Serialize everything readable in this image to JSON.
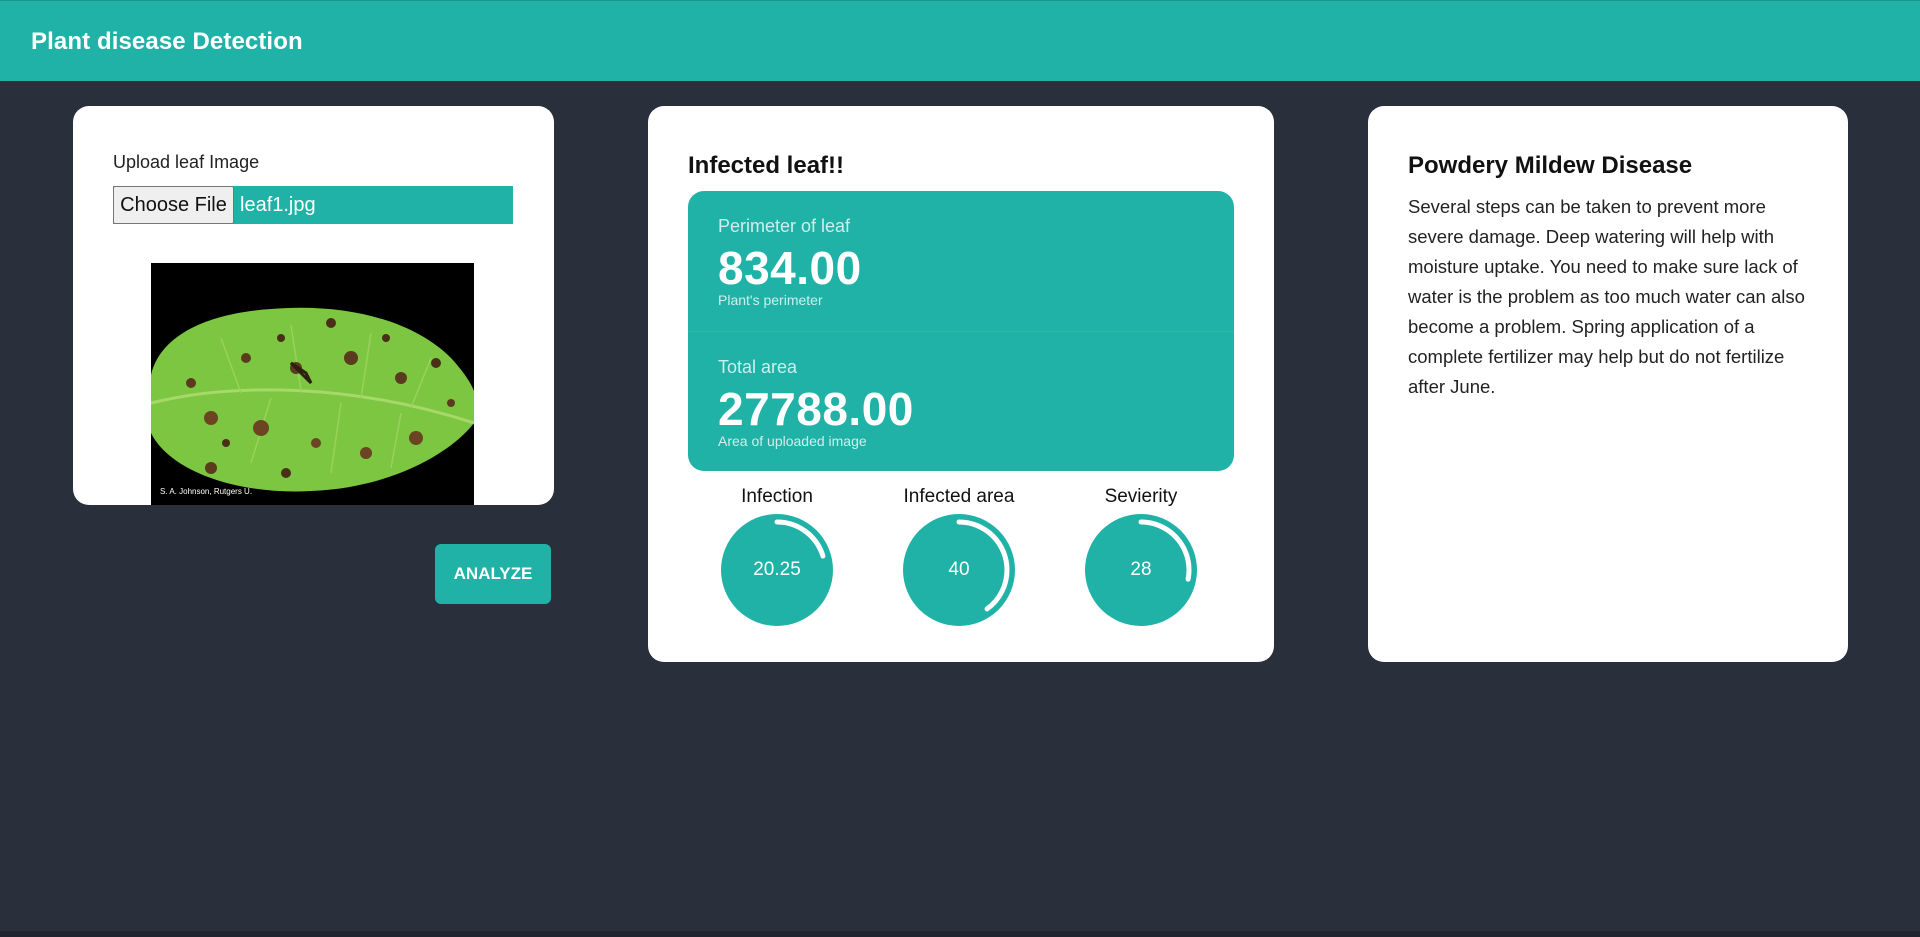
{
  "app": {
    "title": "Plant disease Detection"
  },
  "upload": {
    "label": "Upload leaf Image",
    "choose_file_label": "Choose File",
    "file_name": "leaf1.jpg",
    "image_credit": "S. A. Johnson, Rutgers U."
  },
  "actions": {
    "analyze_label": "ANALYZE"
  },
  "result": {
    "title": "Infected leaf!!",
    "perimeter": {
      "label": "Perimeter of leaf",
      "value": "834.00",
      "sub": "Plant's perimeter"
    },
    "area": {
      "label": "Total area",
      "value": "27788.00",
      "sub": "Area of uploaded image"
    },
    "gauges": [
      {
        "label": "Infection",
        "value": "20.25",
        "percent": 20.25
      },
      {
        "label": "Infected area",
        "value": "40",
        "percent": 40
      },
      {
        "label": "Sevierity",
        "value": "28",
        "percent": 28
      }
    ]
  },
  "info": {
    "title": "Powdery Mildew Disease",
    "body": "Several steps can be taken to prevent more severe damage. Deep watering will help with moisture uptake. You need to make sure lack of water is the problem as too much water can also become a problem. Spring application of a complete fertilizer may help but do not fertilize after June."
  },
  "colors": {
    "accent": "#20b2a7",
    "background": "#292f3b",
    "card": "#ffffff"
  }
}
